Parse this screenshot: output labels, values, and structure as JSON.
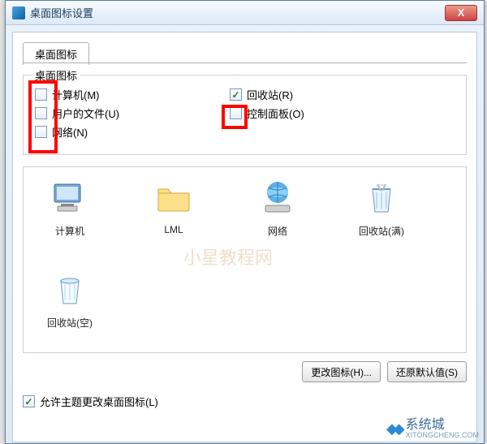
{
  "window": {
    "title": "桌面图标设置",
    "close_glyph": "X"
  },
  "tab": {
    "label": "桌面图标"
  },
  "group": {
    "legend": "桌面图标",
    "items": [
      {
        "label": "计算机(M)",
        "checked": false
      },
      {
        "label": "回收站(R)",
        "checked": true
      },
      {
        "label": "用户的文件(U)",
        "checked": false
      },
      {
        "label": "控制面板(O)",
        "checked": false
      },
      {
        "label": "网络(N)",
        "checked": false
      }
    ]
  },
  "icons": [
    {
      "label": "计算机",
      "kind": "computer"
    },
    {
      "label": "LML",
      "kind": "folder"
    },
    {
      "label": "网络",
      "kind": "network"
    },
    {
      "label": "回收站(满)",
      "kind": "recycle-full"
    },
    {
      "label": "回收站(空)",
      "kind": "recycle-empty"
    }
  ],
  "buttons": {
    "change_icon": "更改图标(H)...",
    "restore_default": "还原默认值(S)"
  },
  "allow_theme": {
    "label": "允许主题更改桌面图标(L)",
    "checked": true
  },
  "watermark": {
    "text": "系统城",
    "url": "XITONGCHENG.COM"
  },
  "midmark": "小星教程网",
  "highlight_color": "#ff0000"
}
